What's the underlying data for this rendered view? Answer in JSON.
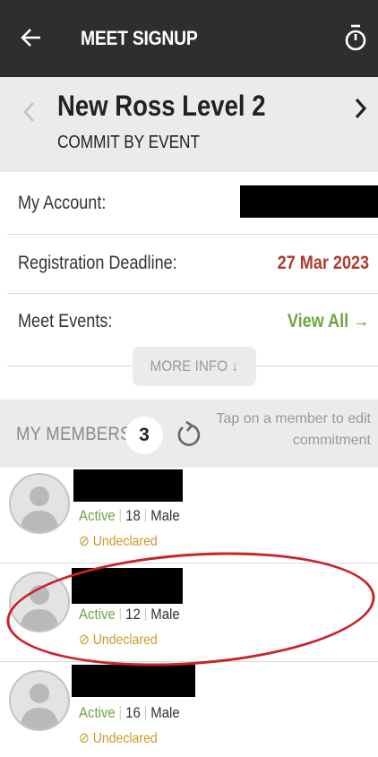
{
  "topbar": {
    "back_icon": "arrow-left-icon",
    "title": "MEET SIGNUP",
    "timer_icon": "stopwatch-icon"
  },
  "meet": {
    "name": "New Ross Level 2",
    "subtitle": "COMMIT BY EVENT",
    "prev_icon": "chevron-left-icon",
    "next_icon": "chevron-right-icon"
  },
  "info": {
    "account_label": "My Account:",
    "deadline_label": "Registration Deadline:",
    "deadline_value": "27 Mar 2023",
    "events_label": "Meet Events:",
    "events_link": "View All →",
    "more_info": "MORE INFO ↓",
    "deadline_color": "#b03a2e",
    "link_color": "#6ea544"
  },
  "members_section": {
    "label": "MY MEMBERS",
    "count": "3",
    "hint": "Tap on a member to edit commitment"
  },
  "members": [
    {
      "status": "Active",
      "age": "18",
      "gender": "Male",
      "commitment": "Undeclared"
    },
    {
      "status": "Active",
      "age": "12",
      "gender": "Male",
      "commitment": "Undeclared"
    },
    {
      "status": "Active",
      "age": "16",
      "gender": "Male",
      "commitment": "Undeclared"
    }
  ]
}
